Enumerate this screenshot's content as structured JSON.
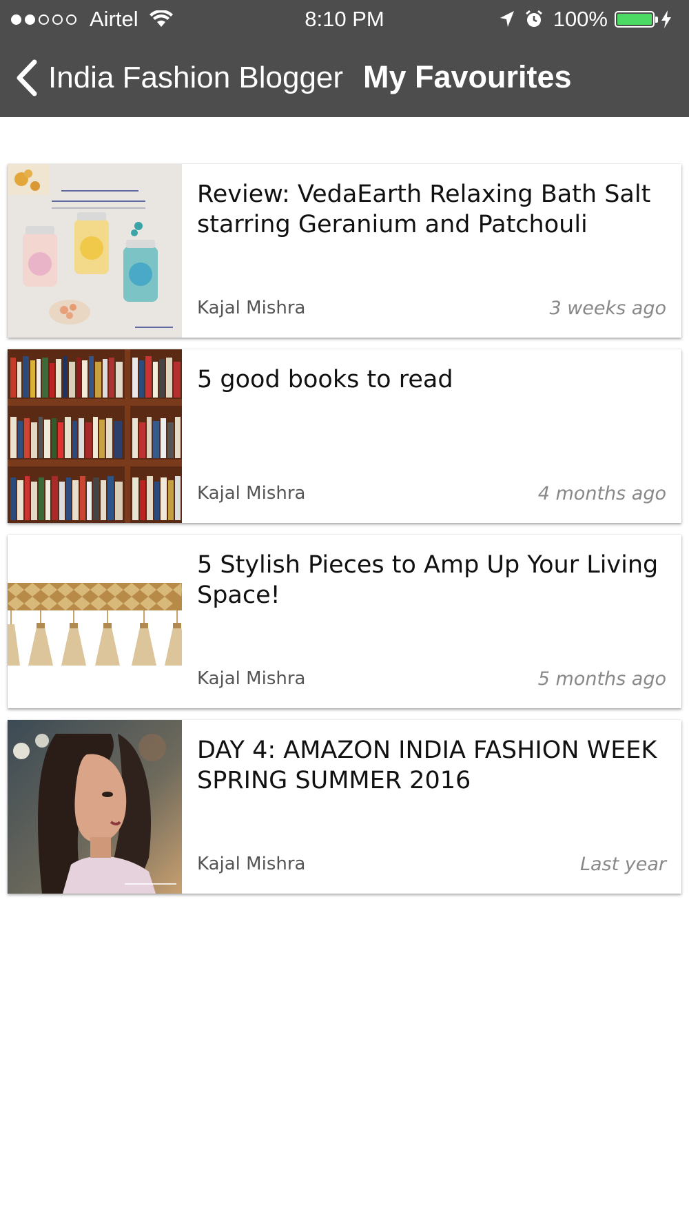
{
  "status_bar": {
    "carrier": "Airtel",
    "signal_bars": 2,
    "time": "8:10 PM",
    "battery": "100%",
    "accent_battery": "#4cd964"
  },
  "nav": {
    "back_label": "India Fashion Blogger",
    "title": "My Favourites"
  },
  "posts": [
    {
      "title": "Review: VedaEarth Relaxing Bath Salt starring Geranium and Patchouli",
      "author": "Kajal Mishra",
      "time": "3 weeks ago",
      "thumb_alt": "bath-salt-jars-photo"
    },
    {
      "title": "5 good books to read",
      "author": "Kajal Mishra",
      "time": "4 months ago",
      "thumb_alt": "bookshelf-photo"
    },
    {
      "title": "5 Stylish Pieces to Amp Up Your Living Space!",
      "author": "Kajal Mishra",
      "time": "5 months ago",
      "thumb_alt": "tassel-trim-photo"
    },
    {
      "title": "DAY 4: AMAZON INDIA FASHION WEEK SPRING SUMMER 2016",
      "author": "Kajal Mishra",
      "time": "Last year",
      "thumb_alt": "portrait-photo"
    }
  ]
}
